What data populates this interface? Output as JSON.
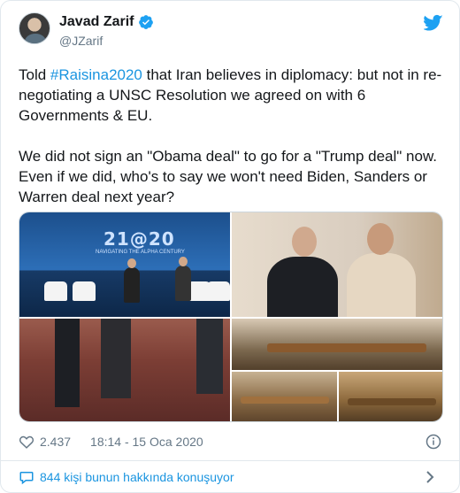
{
  "author": {
    "display_name": "Javad Zarif",
    "handle": "@JZarif",
    "verified": true,
    "avatar_icon": "profile-photo"
  },
  "tweet": {
    "text_before_hashtag": "Told ",
    "hashtag": "#Raisina2020",
    "text_after_hashtag": " that Iran believes in diplomacy: but not in re-negotiating a UNSC Resolution we agreed on with 6 Governments & EU.\n\nWe did not sign an \"Obama deal\" to go for a \"Trump deal\" now. Even if we did, who's to say we won't need Biden, Sanders or Warren deal next year?"
  },
  "media": {
    "stage_banner_text": "21@20",
    "stage_banner_sub": "NAVIGATING THE ALPHA CENTURY"
  },
  "meta": {
    "likes": "2.437",
    "timestamp": "18:14 - 15 Oca 2020"
  },
  "footer": {
    "conversation_text": "844 kişi bunun hakkında konuşuyor"
  },
  "colors": {
    "link": "#1b95e0",
    "text": "#14171a",
    "muted": "#657786",
    "border": "#e1e8ed"
  }
}
